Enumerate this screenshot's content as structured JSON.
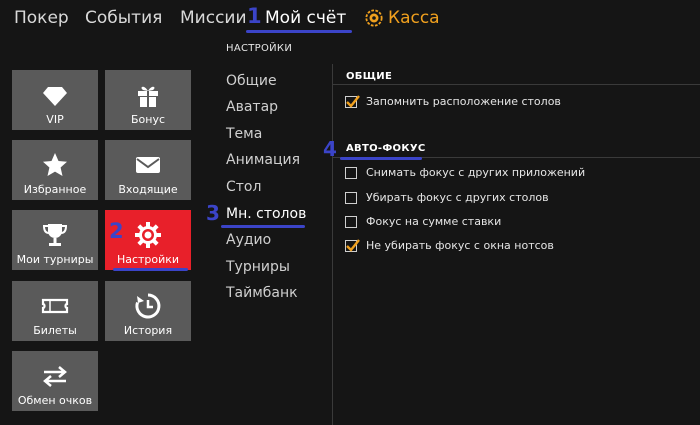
{
  "topnav": {
    "items": [
      "Покер",
      "События",
      "Миссии",
      "Мой счёт"
    ],
    "cash": "Касса"
  },
  "annotations": [
    "1",
    "2",
    "3",
    "4"
  ],
  "tiles": [
    {
      "label": "VIP",
      "icon": "diamond-icon"
    },
    {
      "label": "Бонус",
      "icon": "gift-icon"
    },
    {
      "label": "Избранное",
      "icon": "star-icon"
    },
    {
      "label": "Входящие",
      "icon": "envelope-icon"
    },
    {
      "label": "Мои турниры",
      "icon": "trophy-icon"
    },
    {
      "label": "Настройки",
      "icon": "gear-icon"
    },
    {
      "label": "Билеты",
      "icon": "ticket-icon"
    },
    {
      "label": "История",
      "icon": "history-icon"
    },
    {
      "label": "Обмен очков",
      "icon": "exchange-icon"
    }
  ],
  "settings": {
    "title": "НАСТРОЙКИ",
    "items": [
      "Общие",
      "Аватар",
      "Тема",
      "Анимация",
      "Стол",
      "Мн. столов",
      "Аудио",
      "Турниры",
      "Таймбанк"
    ],
    "active": "Мн. столов"
  },
  "sections": {
    "general": {
      "title": "ОБЩИЕ",
      "options": [
        {
          "label": "Запомнить расположение столов",
          "checked": true
        }
      ]
    },
    "autofocus": {
      "title": "АВТО-ФОКУС",
      "options": [
        {
          "label": "Снимать фокус с других приложений",
          "checked": false
        },
        {
          "label": "Убирать фокус с других столов",
          "checked": false
        },
        {
          "label": "Фокус на сумме ставки",
          "checked": false
        },
        {
          "label": "Не убирать фокус с окна нотсов",
          "checked": true
        }
      ]
    }
  },
  "colors": {
    "accent": "#f0a01e",
    "active_tile": "#e8202a",
    "annotation": "#3b44c8"
  }
}
